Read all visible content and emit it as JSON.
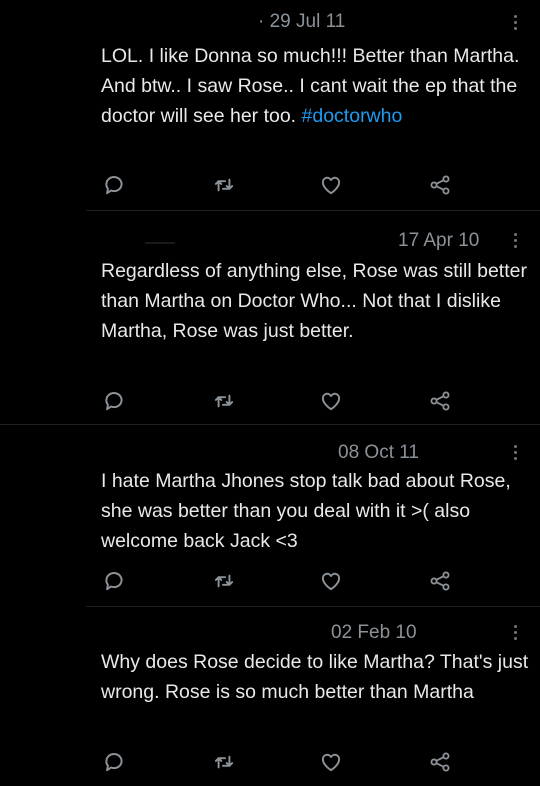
{
  "tweets": [
    {
      "date": "· 29 Jul 11",
      "text": "LOL. I like Donna so much!!! Better than Martha. And btw.. I saw Rose.. I cant wait the ep that the doctor will see her too. ",
      "hashtag": "#doctorwho"
    },
    {
      "date": "17 Apr 10",
      "text": "Regardless of anything else, Rose was still better than Martha on Doctor Who... Not that I dislike Martha, Rose was just better."
    },
    {
      "date": "08 Oct 11",
      "text": "I hate Martha Jhones stop talk bad about Rose, she was better than you deal with it >( also welcome back Jack <3"
    },
    {
      "date": "02 Feb 10",
      "text": "Why does Rose decide to like Martha? That's just wrong. Rose is so much better than Martha"
    }
  ],
  "icons": {
    "reply": "reply-icon",
    "retweet": "retweet-icon",
    "like": "like-icon",
    "share": "share-icon",
    "more": "more-options-icon"
  },
  "colors": {
    "background": "#000000",
    "text": "#e7e9ea",
    "secondary": "#8b9298",
    "hashtag": "#1d9bf0",
    "icon": "#8b9298"
  }
}
